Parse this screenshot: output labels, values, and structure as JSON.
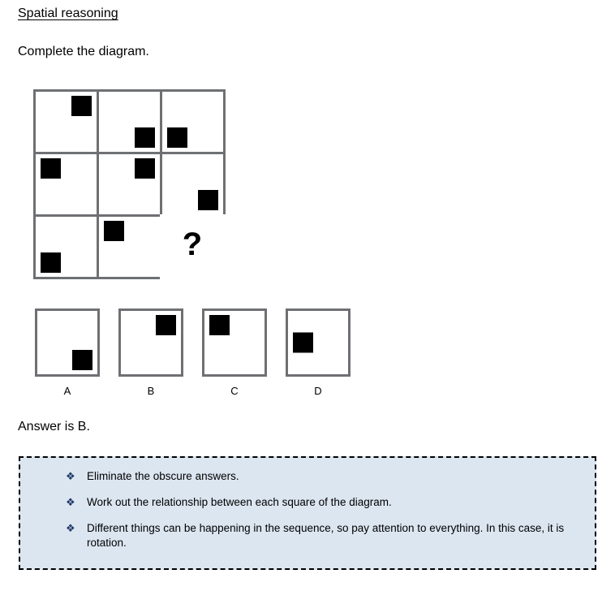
{
  "page": {
    "title": "Spatial reasoning",
    "instruction": "Complete the diagram.",
    "answer_line": "Answer is B."
  },
  "matrix": {
    "rows": 3,
    "columns": 3,
    "cells": [
      {
        "id": "r1c1",
        "square_position": "top-right",
        "open": false,
        "content": ""
      },
      {
        "id": "r1c2",
        "square_position": "bottom-right",
        "open": false,
        "content": ""
      },
      {
        "id": "r1c3",
        "square_position": "bottom-left",
        "open": false,
        "content": ""
      },
      {
        "id": "r2c1",
        "square_position": "top-left",
        "open": false,
        "content": ""
      },
      {
        "id": "r2c2",
        "square_position": "top-right",
        "open": false,
        "content": ""
      },
      {
        "id": "r2c3",
        "square_position": "bottom-right",
        "open": false,
        "content": ""
      },
      {
        "id": "r3c1",
        "square_position": "bottom-left",
        "open": false,
        "content": ""
      },
      {
        "id": "r3c2",
        "square_position": "top-left",
        "open": false,
        "content": ""
      },
      {
        "id": "r3c3",
        "square_position": "none",
        "open": true,
        "content": "?"
      }
    ]
  },
  "options": [
    {
      "label": "A",
      "square_position": "bottom-right"
    },
    {
      "label": "B",
      "square_position": "top-right"
    },
    {
      "label": "C",
      "square_position": "top-left"
    },
    {
      "label": "D",
      "square_position": "middle-left"
    }
  ],
  "tips": {
    "bullet_glyph": "❖",
    "items": [
      "Eliminate the obscure answers.",
      "Work out the relationship between each square of the diagram.",
      "Different things can be happening in the sequence, so pay attention to everything. In this case, it is rotation."
    ]
  },
  "colors": {
    "grid_border": "#6e7073",
    "square_fill": "#000000",
    "tips_background": "#dce6f1",
    "tips_border": "#000000",
    "text": "#000000"
  }
}
